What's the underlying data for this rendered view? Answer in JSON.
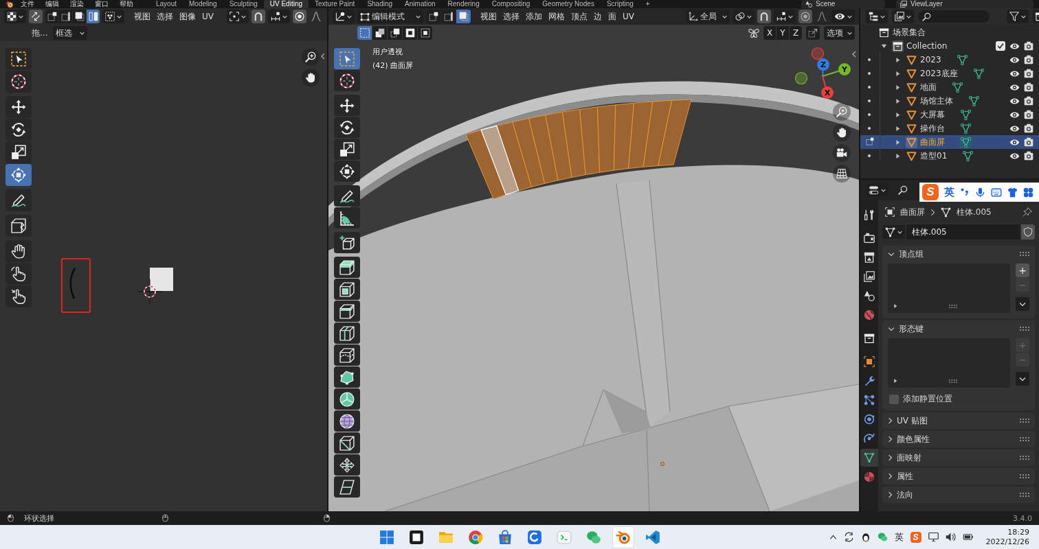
{
  "top_bar": {
    "menus": [
      "文件",
      "编辑",
      "渲染",
      "窗口",
      "帮助"
    ],
    "workspaces": [
      {
        "label": "Layout",
        "selected": false
      },
      {
        "label": "Modeling",
        "selected": false
      },
      {
        "label": "Sculpting",
        "selected": false
      },
      {
        "label": "UV Editing",
        "selected": true
      },
      {
        "label": "Texture Paint",
        "selected": false
      },
      {
        "label": "Shading",
        "selected": false
      },
      {
        "label": "Animation",
        "selected": false
      },
      {
        "label": "Rendering",
        "selected": false
      },
      {
        "label": "Compositing",
        "selected": false
      },
      {
        "label": "Geometry Nodes",
        "selected": false
      },
      {
        "label": "Scripting",
        "selected": false
      }
    ],
    "add_workspace": "+",
    "scene": "Scene",
    "view_layer": "ViewLayer"
  },
  "uv_editor": {
    "header": {
      "select_modes": [
        {
          "kind": "vertex",
          "selected": false
        },
        {
          "kind": "edge",
          "selected": false
        },
        {
          "kind": "face",
          "selected": false
        },
        {
          "kind": "island",
          "selected": true
        }
      ],
      "menus": [
        "视图",
        "选择",
        "图像",
        "UV"
      ]
    },
    "tool_settings": {
      "label": "拖...",
      "select_mode": "框选"
    },
    "tool_groups": [
      [
        {
          "kind": "select",
          "selected": false
        },
        {
          "kind": "cursor",
          "selected": false
        }
      ],
      [
        {
          "kind": "move",
          "selected": false
        },
        {
          "kind": "rotate",
          "selected": false
        },
        {
          "kind": "scale",
          "selected": false
        },
        {
          "kind": "transform",
          "selected": true
        }
      ],
      [
        {
          "kind": "annotate",
          "selected": false
        }
      ],
      [
        {
          "kind": "rip",
          "selected": false
        }
      ],
      [
        {
          "kind": "grab",
          "selected": false
        },
        {
          "kind": "relax",
          "selected": false
        },
        {
          "kind": "pinch",
          "selected": false
        }
      ]
    ]
  },
  "viewport": {
    "header": {
      "mode": "编辑模式",
      "select_modes": [
        {
          "kind": "vertex",
          "selected": false
        },
        {
          "kind": "edge",
          "selected": false
        },
        {
          "kind": "face",
          "selected": true
        }
      ],
      "menus": [
        "视图",
        "选择",
        "添加",
        "网格",
        "顶点",
        "边",
        "面",
        "UV"
      ],
      "orientation": "全局"
    },
    "tool_settings": {
      "select_ops": [
        {
          "kind": "set",
          "selected": true
        },
        {
          "kind": "extend",
          "selected": false
        },
        {
          "kind": "subtract",
          "selected": false
        },
        {
          "kind": "invert",
          "selected": false
        },
        {
          "kind": "intersect",
          "selected": false
        }
      ],
      "mirror_axes": [
        {
          "label": "X",
          "on": false
        },
        {
          "label": "Y",
          "on": false
        },
        {
          "label": "Z",
          "on": false
        }
      ],
      "options": "选项"
    },
    "overlay": {
      "view": "用户透视",
      "object": "(42) 曲面屏"
    },
    "gizmo": [
      {
        "label": "Z",
        "color": "#2f7ee6"
      },
      {
        "label": "Y",
        "color": "#76b82a"
      },
      {
        "label": "X",
        "color": "#e8403b"
      }
    ],
    "tool_groups": [
      [
        {
          "kind": "select",
          "selected": true
        },
        {
          "kind": "cursor",
          "selected": false
        }
      ],
      [
        {
          "kind": "move",
          "selected": false
        },
        {
          "kind": "rotate",
          "selected": false
        },
        {
          "kind": "scale",
          "selected": false
        },
        {
          "kind": "transform",
          "selected": false
        }
      ],
      [
        {
          "kind": "annotate",
          "selected": false
        },
        {
          "kind": "measure",
          "selected": false
        }
      ],
      [
        {
          "kind": "addcube",
          "selected": false
        }
      ],
      [
        {
          "kind": "extrude",
          "selected": false
        },
        {
          "kind": "inset",
          "selected": false
        },
        {
          "kind": "bevel",
          "selected": false
        },
        {
          "kind": "loopcut",
          "selected": false
        },
        {
          "kind": "knife",
          "selected": false
        },
        {
          "kind": "polybuild",
          "selected": false
        },
        {
          "kind": "spin",
          "selected": false
        },
        {
          "kind": "smooth",
          "selected": false
        },
        {
          "kind": "slide",
          "selected": false
        },
        {
          "kind": "shrink",
          "selected": false
        },
        {
          "kind": "shear",
          "selected": false
        }
      ]
    ]
  },
  "outliner": {
    "tree": [
      {
        "kind": "scene_collection",
        "label": "场景集合",
        "selected": false,
        "children": [
          {
            "kind": "collection",
            "label": "Collection",
            "selected": false,
            "expanded": true,
            "checked": true,
            "children": [
              {
                "kind": "mesh",
                "label": "2023",
                "selected": false,
                "expanded": false,
                "editing": false
              },
              {
                "kind": "mesh",
                "label": "2023底座",
                "selected": false,
                "expanded": false,
                "editing": false
              },
              {
                "kind": "mesh",
                "label": "地面",
                "selected": false,
                "expanded": false,
                "editing": false
              },
              {
                "kind": "mesh",
                "label": "场馆主体",
                "selected": false,
                "expanded": false,
                "editing": false
              },
              {
                "kind": "mesh",
                "label": "大屏幕",
                "selected": false,
                "expanded": false,
                "editing": false
              },
              {
                "kind": "mesh",
                "label": "操作台",
                "selected": false,
                "expanded": false,
                "editing": false
              },
              {
                "kind": "mesh",
                "label": "曲面屏",
                "selected": true,
                "expanded": false,
                "editing": true
              },
              {
                "kind": "mesh",
                "label": "造型01",
                "selected": false,
                "expanded": false,
                "editing": false
              }
            ]
          }
        ]
      }
    ]
  },
  "properties": {
    "tab_groups": [
      [
        {
          "kind": "tool",
          "selected": false
        }
      ],
      [
        {
          "kind": "render",
          "selected": false
        },
        {
          "kind": "output",
          "selected": false
        },
        {
          "kind": "view_layer",
          "selected": false
        },
        {
          "kind": "scene",
          "selected": false
        },
        {
          "kind": "world",
          "selected": false
        }
      ],
      [
        {
          "kind": "collection",
          "selected": false
        }
      ],
      [
        {
          "kind": "object",
          "selected": false
        },
        {
          "kind": "modifiers",
          "selected": false
        },
        {
          "kind": "particles",
          "selected": false
        },
        {
          "kind": "physics",
          "selected": false
        },
        {
          "kind": "constraints",
          "selected": false
        },
        {
          "kind": "data",
          "selected": true
        },
        {
          "kind": "material",
          "selected": false
        }
      ]
    ],
    "breadcrumb": [
      "曲面屏",
      "柱体.005"
    ],
    "datablock": "柱体.005",
    "panels": [
      {
        "title": "顶点组",
        "expanded": true,
        "add": {
          "label": "+",
          "disabled": false
        },
        "remove": {
          "label": "−",
          "disabled": true
        }
      },
      {
        "title": "形态键",
        "expanded": true,
        "add": {
          "label": "+",
          "disabled": true
        },
        "remove": {
          "label": "−",
          "disabled": true
        },
        "checkbox": {
          "label": "添加静置位置",
          "checked": false
        }
      },
      {
        "title": "UV 贴图",
        "expanded": false
      },
      {
        "title": "颜色属性",
        "expanded": false
      },
      {
        "title": "面映射",
        "expanded": false
      },
      {
        "title": "属性",
        "expanded": false
      },
      {
        "title": "法向",
        "expanded": false
      }
    ]
  },
  "ime_toolbar": {
    "logo": "S",
    "language": "英"
  },
  "status_bar": {
    "hint": "环状选择",
    "version": "3.4.0"
  },
  "taskbar": {
    "apps": [
      {
        "kind": "start",
        "selected": false
      },
      {
        "kind": "square",
        "selected": false
      },
      {
        "kind": "folder",
        "selected": false
      },
      {
        "kind": "browser",
        "selected": false
      },
      {
        "kind": "store",
        "selected": false
      },
      {
        "kind": "tile",
        "selected": false
      },
      {
        "kind": "terminal",
        "selected": false
      },
      {
        "kind": "chat",
        "selected": false
      },
      {
        "kind": "orbit",
        "selected": true
      },
      {
        "kind": "ribbon",
        "selected": false
      }
    ],
    "tray_language": "英",
    "tray_logo": "S",
    "time": "18:29",
    "date": "2022/12/26"
  }
}
